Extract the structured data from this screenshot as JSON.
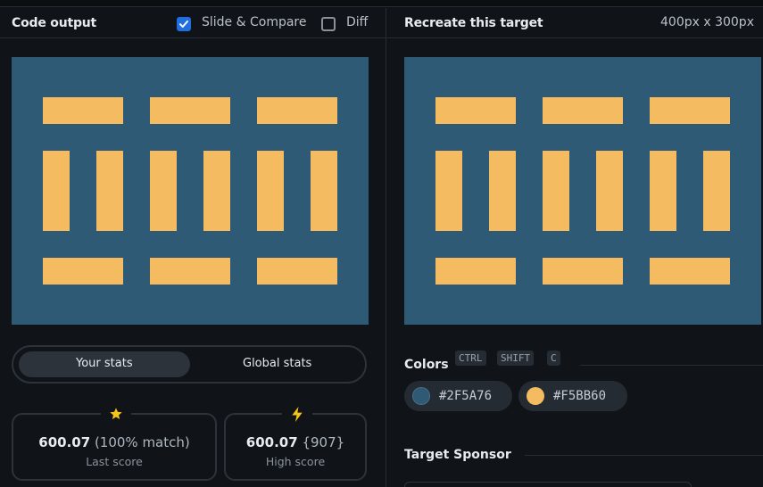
{
  "left_panel": {
    "title": "Code output",
    "slide_compare": {
      "label": "Slide & Compare",
      "checked": true
    },
    "diff": {
      "label": "Diff",
      "checked": false
    }
  },
  "right_panel": {
    "title": "Recreate this target",
    "size": "400px x 300px"
  },
  "stats": {
    "tabs": [
      "Your stats",
      "Global stats"
    ],
    "active_tab": "Your stats",
    "last_score": {
      "value": "600.07",
      "detail": "(100% match)",
      "caption": "Last score",
      "icon": "star-icon"
    },
    "high_score": {
      "value": "600.07",
      "detail": "{907}",
      "caption": "High score",
      "icon": "bolt-icon"
    }
  },
  "colors_section": {
    "title": "Colors",
    "shortcut": [
      "CTRL",
      "SHIFT",
      "C"
    ],
    "swatches": [
      {
        "hex": "#2F5A76",
        "color": "#2F5A76"
      },
      {
        "hex": "#F5BB60",
        "color": "#F5BB60"
      }
    ]
  },
  "sponsor": {
    "title": "Target Sponsor"
  }
}
